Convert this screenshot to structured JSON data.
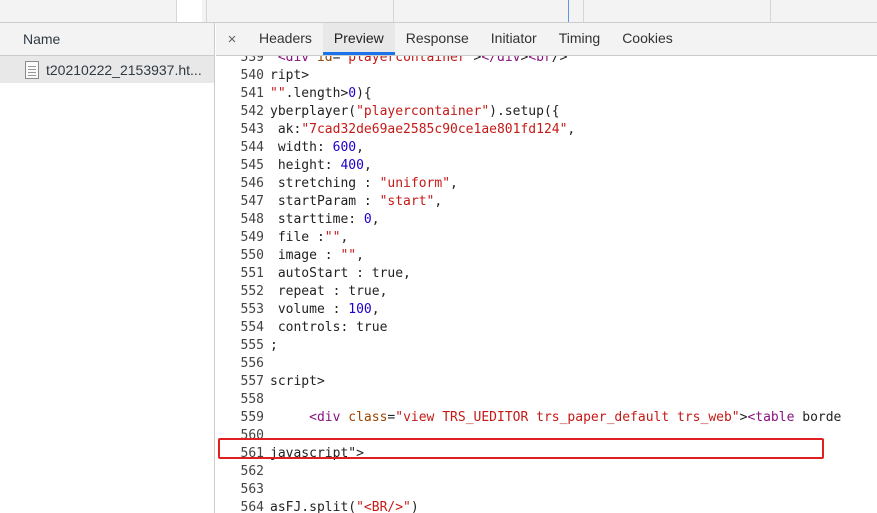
{
  "left_panel": {
    "header": "Name",
    "requests": [
      {
        "name": "t20210222_2153937.ht..."
      }
    ]
  },
  "tabs": {
    "close_glyph": "×",
    "items": [
      {
        "label": "Headers"
      },
      {
        "label": "Preview"
      },
      {
        "label": "Response"
      },
      {
        "label": "Initiator"
      },
      {
        "label": "Timing"
      },
      {
        "label": "Cookies"
      }
    ],
    "active_tab": "Preview"
  },
  "code_lines": [
    {
      "num": "539",
      "text": " <div id=\"playercontainer\"></div><br/>"
    },
    {
      "num": "540",
      "text": "ript>"
    },
    {
      "num": "541",
      "text": "\"\".length>0){"
    },
    {
      "num": "542",
      "text": "yberplayer(\"playercontainer\").setup({"
    },
    {
      "num": "543",
      "text": " ak:\"7cad32de69ae2585c90ce1ae801fd124\","
    },
    {
      "num": "544",
      "text": " width: 600,"
    },
    {
      "num": "545",
      "text": " height: 400,"
    },
    {
      "num": "546",
      "text": " stretching : \"uniform\","
    },
    {
      "num": "547",
      "text": " startParam : \"start\","
    },
    {
      "num": "548",
      "text": " starttime: 0,"
    },
    {
      "num": "549",
      "text": " file :\"\","
    },
    {
      "num": "550",
      "text": " image : \"\","
    },
    {
      "num": "551",
      "text": " autoStart : true,"
    },
    {
      "num": "552",
      "text": " repeat : true,"
    },
    {
      "num": "553",
      "text": " volume : 100,"
    },
    {
      "num": "554",
      "text": " controls: true"
    },
    {
      "num": "555",
      "text": ";"
    },
    {
      "num": "556",
      "text": ""
    },
    {
      "num": "557",
      "text": "script>"
    },
    {
      "num": "558",
      "text": ""
    },
    {
      "num": "559",
      "text": "     <div class=\"view TRS_UEDITOR trs_paper_default trs_web\"><table borde"
    },
    {
      "num": "560",
      "text": ""
    },
    {
      "num": "561",
      "text": "javascript\">"
    },
    {
      "num": "562",
      "text": ""
    },
    {
      "num": "563",
      "text": ""
    },
    {
      "num": "564",
      "text": "asFJ.split(\"<BR/>\")"
    }
  ],
  "highlighted_line": "559",
  "colors": {
    "accent_blue": "#1a73e8",
    "highlight_red": "#e02020",
    "string": "#c41a16",
    "number": "#1c00cf",
    "tag": "#881280"
  }
}
